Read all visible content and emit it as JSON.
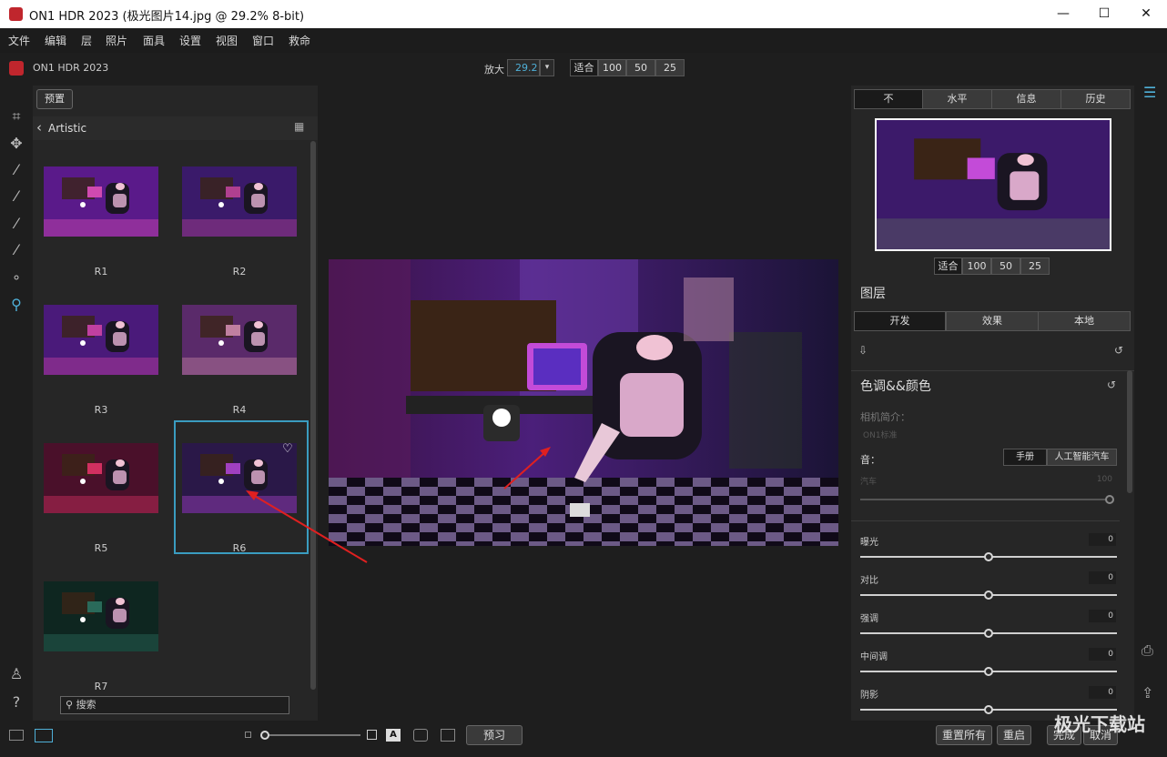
{
  "window": {
    "title": "ON1 HDR 2023 (极光图片14.jpg @ 29.2% 8-bit)",
    "minimize": "—",
    "maximize": "☐",
    "close": "✕"
  },
  "menu": [
    "文件",
    "编辑",
    "层",
    "照片",
    "面具",
    "设置",
    "视图",
    "窗口",
    "救命"
  ],
  "toolbar": {
    "app_title": "ON1 HDR 2023",
    "zoom_label": "放大",
    "zoom_value": "29.2",
    "zoom_buttons": [
      "适合",
      "100",
      "50",
      "25"
    ]
  },
  "browse": {
    "presets_button": "预置",
    "category": "Artistic",
    "presets": [
      {
        "label": "R1"
      },
      {
        "label": "R2"
      },
      {
        "label": "R3"
      },
      {
        "label": "R4"
      },
      {
        "label": "R5"
      },
      {
        "label": "R6",
        "selected": true
      },
      {
        "label": "R7"
      }
    ],
    "search_placeholder": "搜索"
  },
  "right": {
    "tabs": [
      "不",
      "水平",
      "信息",
      "历史"
    ],
    "nav_zoom": [
      "适合",
      "100",
      "50",
      "25"
    ],
    "layers_title": "图层",
    "module_tabs": [
      "开发",
      "效果",
      "本地"
    ],
    "tone_title": "色调&&颜色",
    "camera_profile_label": "相机简介：",
    "camera_profile_value": "ON1标准",
    "tone_label": "音：",
    "tone_modes": [
      "手册",
      "人工智能汽车"
    ],
    "auto_label": "汽车",
    "auto_value": "100",
    "sliders": [
      {
        "label": "曝光",
        "value": "0"
      },
      {
        "label": "对比",
        "value": "0"
      },
      {
        "label": "强调",
        "value": "0"
      },
      {
        "label": "中间调",
        "value": "0"
      },
      {
        "label": "阴影",
        "value": "0"
      }
    ]
  },
  "bottom": {
    "preview_button": "预习",
    "reset_all": "重置所有",
    "reset": "重启",
    "done": "完成",
    "cancel": "取消",
    "watermark": "极光下载站"
  },
  "colors": {
    "accent": "#4fb0d8",
    "selection": "#3a9cc0",
    "arrow": "#e02020"
  }
}
